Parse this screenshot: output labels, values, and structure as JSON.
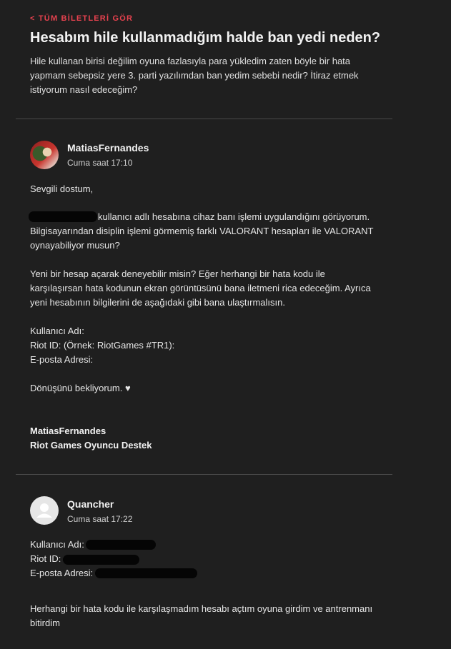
{
  "header": {
    "back_link": "< TÜM BİLETLERİ GÖR",
    "title": "Hesabım hile kullanmadığım halde ban yedi neden?",
    "description": "Hile kullanan birisi değilim oyuna fazlasıyla para yükledim zaten böyle bir hata yapmam sebepsiz yere 3. parti yazılımdan ban yedim sebebi nedir? İtiraz etmek istiyorum nasıl edeceğim?"
  },
  "messages": [
    {
      "author": "MatiasFernandes",
      "time": "Cuma saat 17:10",
      "avatar_icon": "agent-avatar",
      "lines": {
        "greeting": "Sevgili dostum,",
        "p1_l1": "kullanıcı adlı hesabına cihaz banı işlemi uygulandığını görüyorum.",
        "p1_l2": "Bilgisayarından disiplin işlemi görmemiş farklı VALORANT hesapları ile VALORANT",
        "p1_l3": "oynayabiliyor musun?",
        "p2_l1": "Yeni bir hesap açarak deneyebilir misin? Eğer herhangi bir hata kodu ile",
        "p2_l2": "karşılaşırsan hata kodunun ekran görüntüsünü bana iletmeni rica edeceğim. Ayrıca",
        "p2_l3": "yeni hesabının bilgilerini de aşağıdaki gibi bana ulaştırmalısın.",
        "f1": "Kullanıcı Adı:",
        "f2": "Riot ID: (Örnek: RiotGames #TR1):",
        "f3": "E-posta Adresi:",
        "closing": "Dönüşünü bekliyorum. ♥",
        "sig_name": "MatiasFernandes",
        "sig_team": "Riot Games Oyuncu Destek"
      }
    },
    {
      "author": "Quancher",
      "time": "Cuma saat 17:22",
      "avatar_icon": "default-user-icon",
      "lines": {
        "f1": "Kullanıcı Adı:",
        "f2": "Riot ID:",
        "f3": "E-posta Adresi:",
        "p1_l1": "Herhangi bir hata kodu ile karşılaşmadım hesabı açtım oyuna girdim ve antrenmanı",
        "p1_l2": "bitirdim"
      }
    }
  ]
}
